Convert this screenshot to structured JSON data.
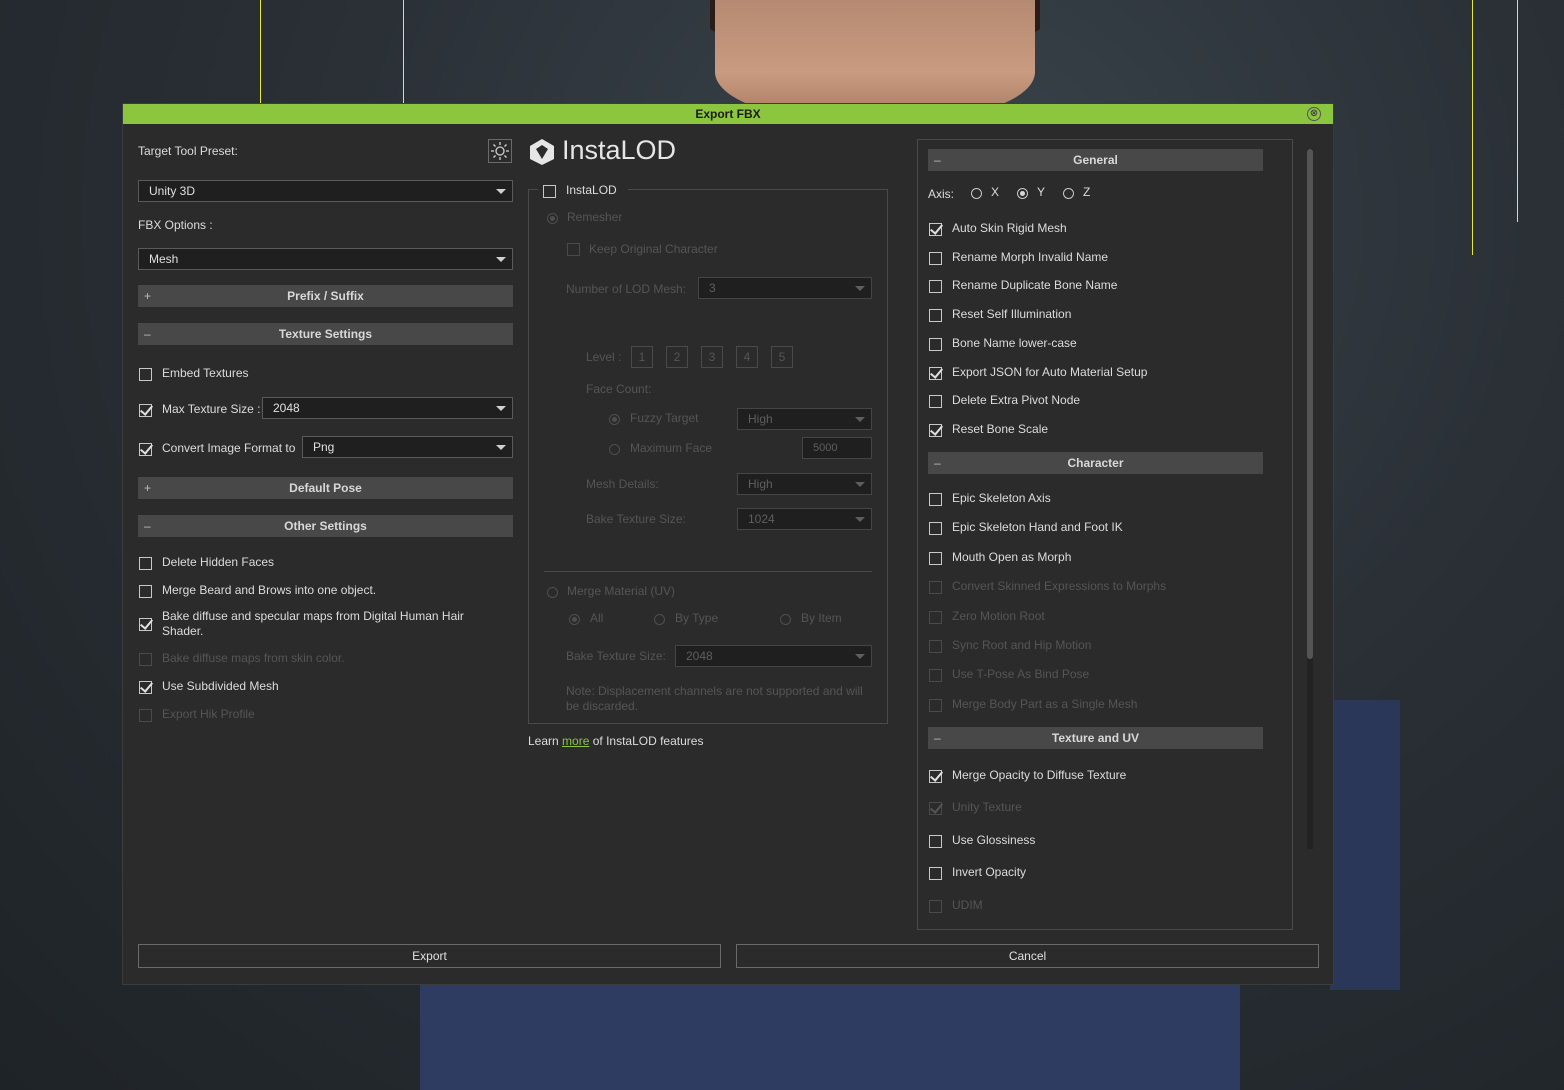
{
  "dialog": {
    "title": "Export FBX",
    "close_glyph": "⊗"
  },
  "left": {
    "preset_label": "Target Tool Preset:",
    "preset_value": "Unity 3D",
    "fbx_options_label": "FBX Options :",
    "fbx_options_value": "Mesh",
    "sections": {
      "prefix": {
        "label": "Prefix / Suffix",
        "toggle": "+"
      },
      "texture": {
        "label": "Texture Settings",
        "toggle": "–"
      },
      "default_pose": {
        "label": "Default Pose",
        "toggle": "+"
      },
      "other": {
        "label": "Other Settings",
        "toggle": "–"
      }
    },
    "embed_textures": "Embed Textures",
    "max_texture_label": "Max Texture Size :",
    "max_texture_value": "2048",
    "convert_label": "Convert Image Format to",
    "convert_value": "Png",
    "other_items": [
      "Delete Hidden Faces",
      "Merge Beard and Brows into one object.",
      "Bake diffuse and specular maps from Digital Human Hair Shader.",
      "Bake diffuse maps from skin color.",
      "Use Subdivided Mesh",
      "Export Hik Profile"
    ]
  },
  "middle": {
    "logo_text": "InstaLOD",
    "instalod_checkbox": "InstaLOD",
    "remesher": "Remesher",
    "keep_original": "Keep Original Character",
    "lod_mesh_label": "Number of LOD Mesh:",
    "lod_mesh_value": "3",
    "level_label": "Level :",
    "levels": [
      "1",
      "2",
      "3",
      "4",
      "5"
    ],
    "face_count": "Face Count:",
    "fuzzy_target": "Fuzzy Target",
    "fuzzy_value": "High",
    "maximum_face": "Maximum Face",
    "maximum_value": "5000",
    "mesh_details_label": "Mesh Details:",
    "mesh_details_value": "High",
    "bake_size_label": "Bake Texture Size:",
    "bake_size_value": "1024",
    "merge_material": "Merge Material (UV)",
    "merge_all": "All",
    "merge_by_type": "By Type",
    "merge_by_item": "By Item",
    "bake_size2_value": "2048",
    "note": "Note: Displacement channels are not supported and will be discarded.",
    "learn_prefix": "Learn",
    "learn_link": "more",
    "learn_suffix": "of InstaLOD features"
  },
  "right": {
    "general_label": "General",
    "axis_label": "Axis:",
    "axis_options": [
      "X",
      "Y",
      "Z"
    ],
    "general_items": [
      "Auto Skin Rigid Mesh",
      "Rename Morph Invalid Name",
      "Rename Duplicate Bone Name",
      "Reset Self Illumination",
      "Bone Name lower-case",
      "Export JSON for Auto Material Setup",
      "Delete Extra Pivot Node",
      "Reset Bone Scale"
    ],
    "character_label": "Character",
    "character_items": [
      "Epic Skeleton Axis",
      "Epic Skeleton Hand and Foot IK",
      "Mouth Open as Morph",
      "Convert Skinned Expressions to Morphs",
      "Zero Motion Root",
      "Sync Root and Hip Motion",
      "Use T-Pose As Bind Pose",
      "Merge Body Part as a Single Mesh"
    ],
    "texture_uv_label": "Texture and UV",
    "texture_items": [
      "Merge Opacity to Diffuse Texture",
      "Unity Texture",
      "Use Glossiness",
      "Invert Opacity",
      "UDIM"
    ]
  },
  "footer": {
    "export_label": "Export",
    "cancel_label": "Cancel"
  }
}
